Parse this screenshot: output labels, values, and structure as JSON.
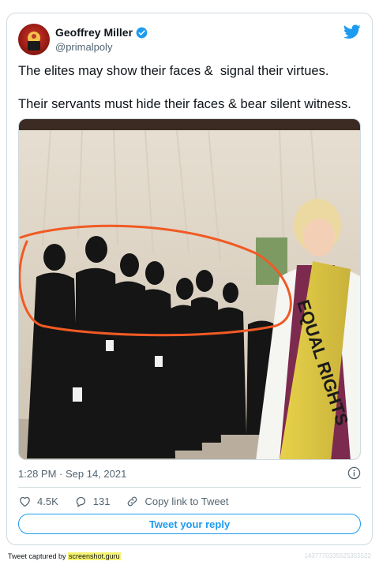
{
  "author": {
    "display_name": "Geoffrey Miller",
    "handle": "@primalpoly",
    "verified": true,
    "avatar_icon": "avatar-icon"
  },
  "tweet": {
    "line1": "The elites may show their faces &  signal their virtues.",
    "line2": "Their servants must hide their faces & bear silent witness.",
    "sash_text": "EQUAL RIGHTS",
    "timestamp": "1:28 PM · Sep 14, 2021"
  },
  "actions": {
    "likes": "4.5K",
    "replies": "131",
    "copy_link": "Copy link to Tweet",
    "reply_button": "Tweet your reply"
  },
  "footer": {
    "prefix": "Tweet captured by ",
    "brand": "screenshot.guru",
    "tweet_id": "1437770335525355522"
  },
  "colors": {
    "accent": "#1d9bf0",
    "secondary_text": "#536471",
    "border": "#cfd9de",
    "annotation": "#f05a24"
  }
}
